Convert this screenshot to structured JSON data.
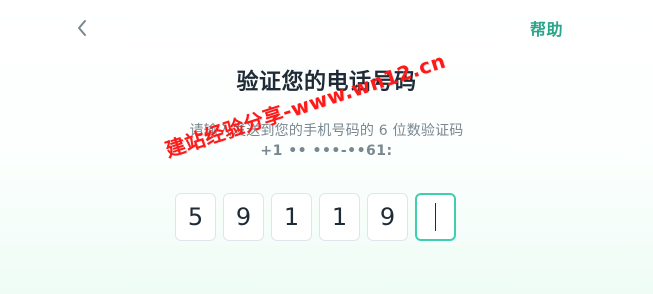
{
  "header": {
    "back_icon": "chevron-left-icon",
    "help_label": "帮助",
    "accent_color": "#2aa48a"
  },
  "main": {
    "title": "验证您的电话号码",
    "subtitle": "请输入发送到您的手机号码的 6 位数验证码",
    "phone_masked": "+1 •• •••-••61:",
    "code_digits": [
      "5",
      "9",
      "1",
      "1",
      "9",
      ""
    ],
    "active_index": 5,
    "active_border_color": "#3fcfb0"
  },
  "watermark": {
    "text": "建站经验分享-www.wn12.cn"
  }
}
